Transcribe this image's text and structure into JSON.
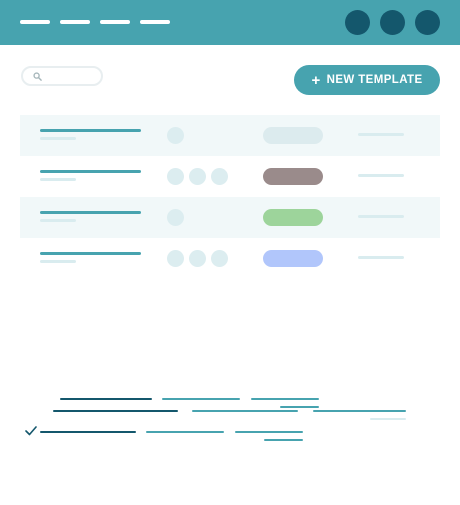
{
  "colors": {
    "accent": "#47a3af",
    "header_bg": "#47a3af",
    "avatar": "#14576c",
    "row_alt_bg": "#f1f8f9"
  },
  "header": {
    "nav_items": [
      "",
      "",
      "",
      ""
    ],
    "avatar_count": 3
  },
  "search": {
    "placeholder": "",
    "value": "",
    "icon": "search-icon"
  },
  "actions": {
    "new_template_label": "NEW TEMPLATE",
    "new_template_icon": "plus-icon"
  },
  "templates": [
    {
      "assignee_count": 1,
      "status_color": "#dcebee"
    },
    {
      "assignee_count": 3,
      "status_color": "#9a8b8b"
    },
    {
      "assignee_count": 1,
      "status_color": "#9dd49b"
    },
    {
      "assignee_count": 3,
      "status_color": "#b1c6fb"
    }
  ],
  "footer": {
    "check_icon": "check-icon"
  }
}
